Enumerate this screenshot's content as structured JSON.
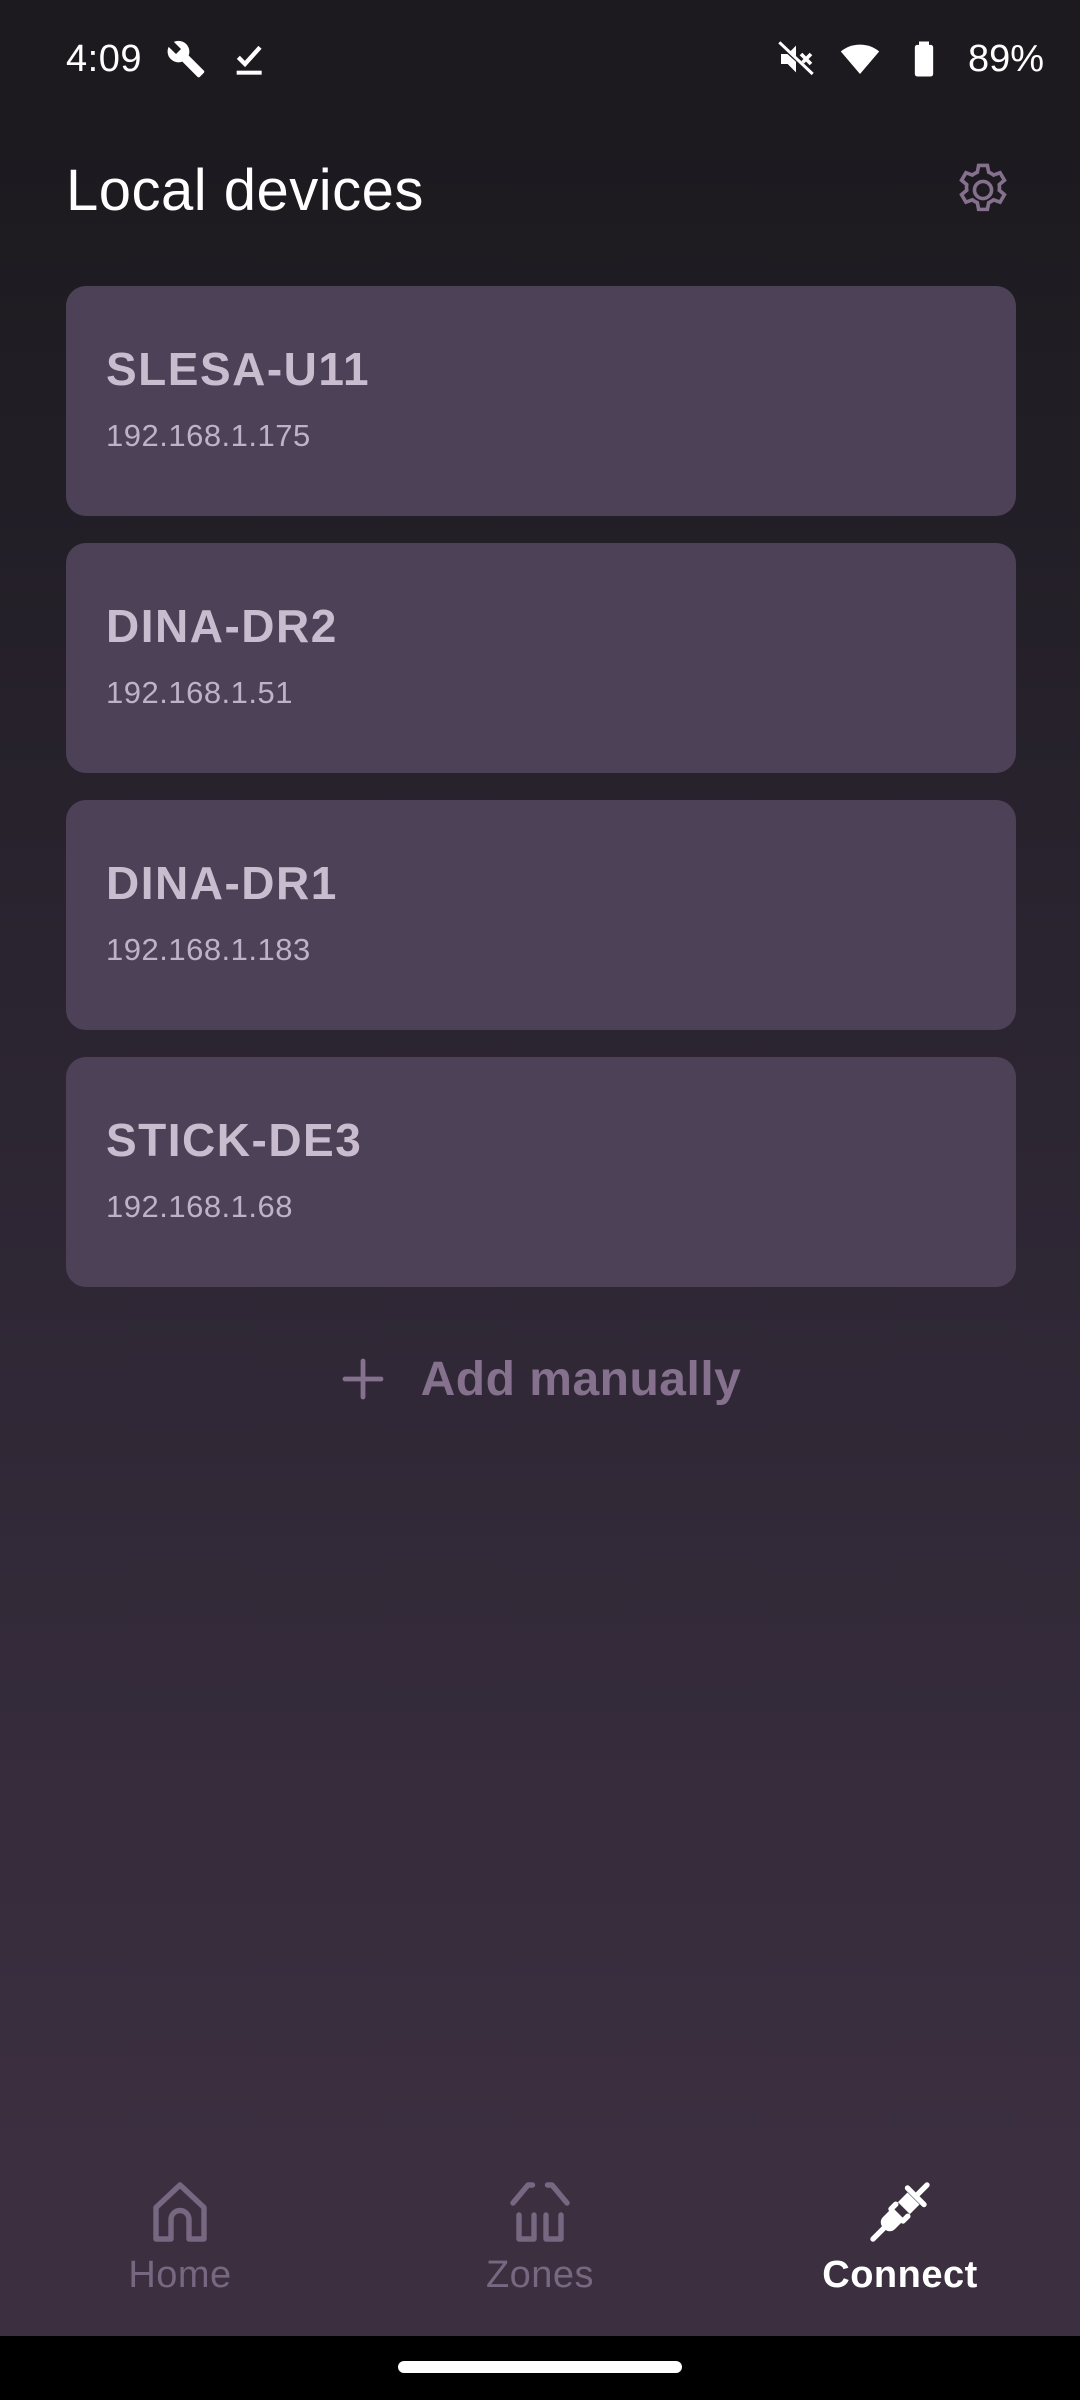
{
  "status_bar": {
    "time": "4:09",
    "battery_percent": "89%",
    "icons": [
      "wrench-icon",
      "checkmark-icon",
      "mute-icon",
      "wifi-icon",
      "battery-icon"
    ]
  },
  "header": {
    "title": "Local devices",
    "settings_icon": "gear-icon"
  },
  "devices": [
    {
      "name": "SLESA-U11",
      "ip": "192.168.1.175"
    },
    {
      "name": "DINA-DR2",
      "ip": "192.168.1.51"
    },
    {
      "name": "DINA-DR1",
      "ip": "192.168.1.183"
    },
    {
      "name": "STICK-DE3",
      "ip": "192.168.1.68"
    }
  ],
  "add_manually": {
    "label": "Add manually",
    "icon": "plus-icon"
  },
  "bottom_nav": {
    "items": [
      {
        "label": "Home",
        "icon": "home-icon",
        "active": false
      },
      {
        "label": "Zones",
        "icon": "zones-icon",
        "active": false
      },
      {
        "label": "Connect",
        "icon": "plug-icon",
        "active": true
      }
    ]
  },
  "colors": {
    "background": "#1c1a1f",
    "card": "#4d4157",
    "card_text": "#c9bccf",
    "accent_muted": "#85718d",
    "nav_background": "#3b2f40",
    "nav_active": "#ffffff",
    "nav_inactive": "#776781"
  }
}
